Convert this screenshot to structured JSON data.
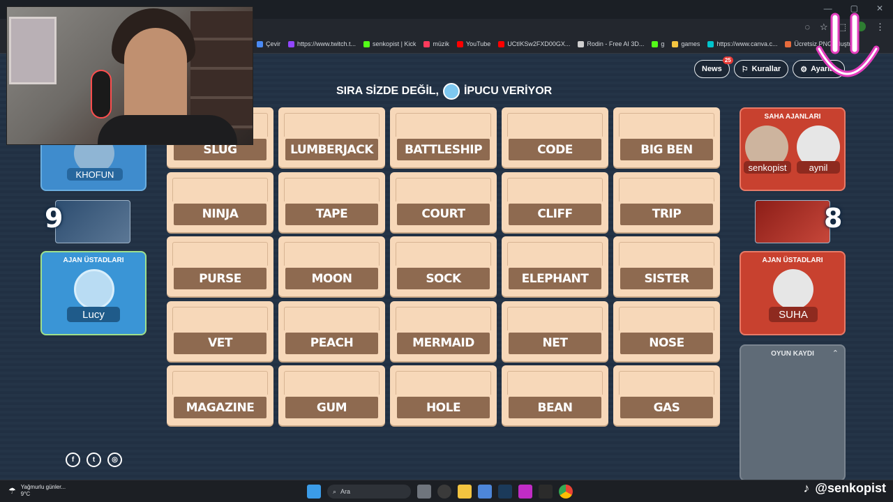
{
  "browser": {
    "bookmarks": [
      {
        "label": "Çevir",
        "icon": "translate-icon",
        "color": "#4a8af4"
      },
      {
        "label": "https://www.twitch.t...",
        "icon": "twitch-icon",
        "color": "#9146ff"
      },
      {
        "label": "senkopist | Kick",
        "icon": "kick-icon",
        "color": "#53fc18"
      },
      {
        "label": "müzik",
        "icon": "music-icon",
        "color": "#ff3b5c"
      },
      {
        "label": "YouTube",
        "icon": "youtube-icon",
        "color": "#ff0000"
      },
      {
        "label": "UCtIKSw2FXD00GX...",
        "icon": "youtube-icon",
        "color": "#ff0000"
      },
      {
        "label": "Rodin - Free AI 3D...",
        "icon": "rodin-icon",
        "color": "#cfcfcf"
      },
      {
        "label": "g",
        "icon": "kick-icon",
        "color": "#53fc18"
      },
      {
        "label": "games",
        "icon": "folder-icon",
        "color": "#f3c440"
      },
      {
        "label": "https://www.canva.c...",
        "icon": "canva-icon",
        "color": "#00c4cc"
      },
      {
        "label": "Ücretsiz PNG Oluştu...",
        "icon": "image-icon",
        "color": "#e66b3c"
      }
    ]
  },
  "header": {
    "news_label": "News",
    "news_badge": "25",
    "rules_label": "Kurallar",
    "settings_label": "Ayarlar",
    "turn_text_before": "SIRA SİZDE DEĞİL,",
    "turn_avatar_name": "Lucy",
    "turn_text_after": "İPUCU VERİYOR"
  },
  "board": {
    "cards": [
      "SLUG",
      "LUMBERJACK",
      "BATTLESHIP",
      "CODE",
      "BIG BEN",
      "NINJA",
      "TAPE",
      "COURT",
      "CLIFF",
      "TRIP",
      "PURSE",
      "MOON",
      "SOCK",
      "ELEPHANT",
      "SISTER",
      "VET",
      "PEACH",
      "MERMAID",
      "NET",
      "NOSE",
      "MAGAZINE",
      "GUM",
      "HOLE",
      "BEAN",
      "GAS"
    ]
  },
  "blue_team": {
    "operatives": [
      "KHOFUN"
    ],
    "score": "9",
    "spymaster_title": "AJAN ÜSTADLARI",
    "spymaster": "Lucy",
    "color": "#3a95d6"
  },
  "red_team": {
    "operatives_title": "SAHA AJANLARI",
    "operatives": [
      "senkopist",
      "aynil"
    ],
    "score": "8",
    "spymaster_title": "AJAN ÜSTADLARI",
    "spymaster": "SUHA",
    "color": "#c8412f"
  },
  "game_log": {
    "title": "OYUN KAYDI"
  },
  "taskbar": {
    "weather_line1": "Yağmurlu günler...",
    "weather_line2": "9°C",
    "search_placeholder": "Ara"
  },
  "overlay": {
    "tiktok_handle": "@senkopist"
  }
}
